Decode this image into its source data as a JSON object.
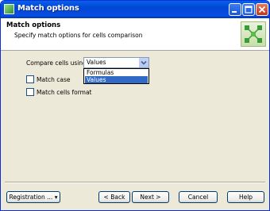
{
  "window": {
    "title": "Match options"
  },
  "header": {
    "title": "Match options",
    "subtitle": "Specify match options for cells comparison"
  },
  "form": {
    "compare_label": "Compare cells using:",
    "compare_value": "Values",
    "options": [
      "Formulas",
      "Values"
    ],
    "selected_option": "Values",
    "match_case_label": "Match case",
    "match_case_checked": false,
    "match_format_label": "Match cells format",
    "match_format_checked": false
  },
  "buttons": {
    "registration": "Registration ...",
    "back": "< Back",
    "next": "Next >",
    "cancel": "Cancel",
    "help": "Help"
  },
  "colors": {
    "titlebar": "#0046d5",
    "selection": "#316ac5",
    "logo_green": "#2e8b3a"
  }
}
